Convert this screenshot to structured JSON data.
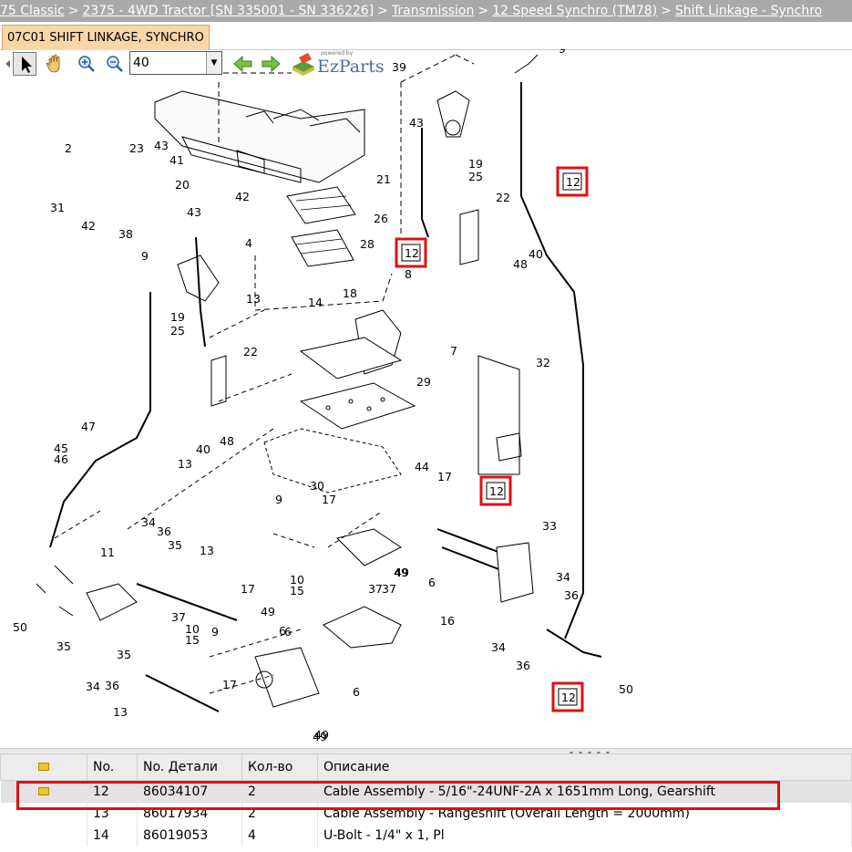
{
  "breadcrumb": [
    {
      "label": "75 Classic"
    },
    {
      "label": "2375 - 4WD Tractor [SN 335001 - SN 336226]"
    },
    {
      "label": "Transmission"
    },
    {
      "label": "12 Speed Synchro (TM78)"
    },
    {
      "label": "Shift Linkage - Synchro"
    }
  ],
  "tab": {
    "label": "07C01 SHIFT LINKAGE, SYNCHRO"
  },
  "toolbar": {
    "zoom_value": "40",
    "icons": [
      "pointer-icon",
      "hand-icon",
      "zoom-in-icon",
      "zoom-out-icon",
      "back-arrow-icon",
      "forward-arrow-icon"
    ]
  },
  "logo": {
    "brand": "EzParts",
    "powered": "powered by"
  },
  "diagram": {
    "labels": [
      "39",
      "9",
      "43",
      "19",
      "25",
      "22",
      "40",
      "48",
      "2",
      "23",
      "43",
      "41",
      "20",
      "31",
      "42",
      "38",
      "42",
      "43",
      "4",
      "21",
      "26",
      "28",
      "9",
      "19",
      "25",
      "13",
      "14",
      "18",
      "8",
      "7",
      "22",
      "29",
      "40",
      "48",
      "47",
      "45",
      "46",
      "13",
      "30",
      "44",
      "17",
      "9",
      "17",
      "32",
      "34",
      "36",
      "35",
      "13",
      "11",
      "37",
      "10",
      "15",
      "17",
      "9",
      "10",
      "15",
      "49",
      "6",
      "49",
      "16",
      "37",
      "6",
      "49",
      "33",
      "34",
      "36",
      "37",
      "34",
      "36",
      "35",
      "13",
      "17",
      "50",
      "35",
      "50",
      "34",
      "36",
      "12",
      "12",
      "12",
      "12",
      "6",
      "49",
      "6",
      "49",
      "12"
    ],
    "callouts": [
      "12",
      "12",
      "12",
      "12"
    ]
  },
  "table": {
    "headers": [
      "No.",
      "No. Детали",
      "Кол-во",
      "Описание"
    ],
    "rows": [
      {
        "no": "12",
        "part": "86034107",
        "qty": "2",
        "desc": "Cable Assembly - 5/16\"-24UNF-2A x 1651mm Long, Gearshift"
      },
      {
        "no": "13",
        "part": "86017934",
        "qty": "2",
        "desc": "Cable Assembly - Rangeshift (Overall Length = 2000mm)"
      },
      {
        "no": "14",
        "part": "86019053",
        "qty": "4",
        "desc": "U-Bolt - 1/4\" x 1, Pl"
      }
    ]
  },
  "colors": {
    "highlight": "#e01010",
    "breadcrumb_bg": "#a9a9a9",
    "tab_bg": "#f7d7a8"
  }
}
